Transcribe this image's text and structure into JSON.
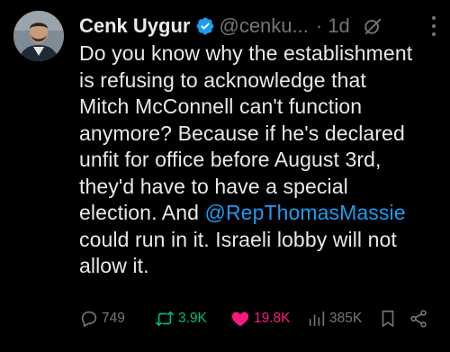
{
  "author": {
    "name": "Cenk Uygur",
    "handle": "@cenku...",
    "separator": "·",
    "time": "1d",
    "verified_color": "#1d9bf0"
  },
  "tweet": {
    "text_before_mention": "Do you know why the establishment\nis refusing to acknowledge that\nMitch McConnell can't function\nanymore? Because if he's declared\nunfit for office before August 3rd,\nthey'd have to have a special\nelection. And ",
    "mention": "@RepThomasMassie",
    "text_after_mention": "\ncould run in it. Israeli lobby will not\nallow it."
  },
  "actions": {
    "replies": "749",
    "retweets": "3.9K",
    "likes": "19.8K",
    "views": "385K"
  },
  "colors": {
    "background": "#000000",
    "text": "#e7e9ea",
    "muted": "#71767b",
    "link": "#1d9bf0",
    "retweet": "#00ba7c",
    "like": "#f91880"
  },
  "icons": [
    "verified-badge-icon",
    "grok-icon",
    "more-icon",
    "reply-icon",
    "retweet-icon",
    "like-icon",
    "views-icon",
    "bookmark-icon",
    "share-icon"
  ]
}
